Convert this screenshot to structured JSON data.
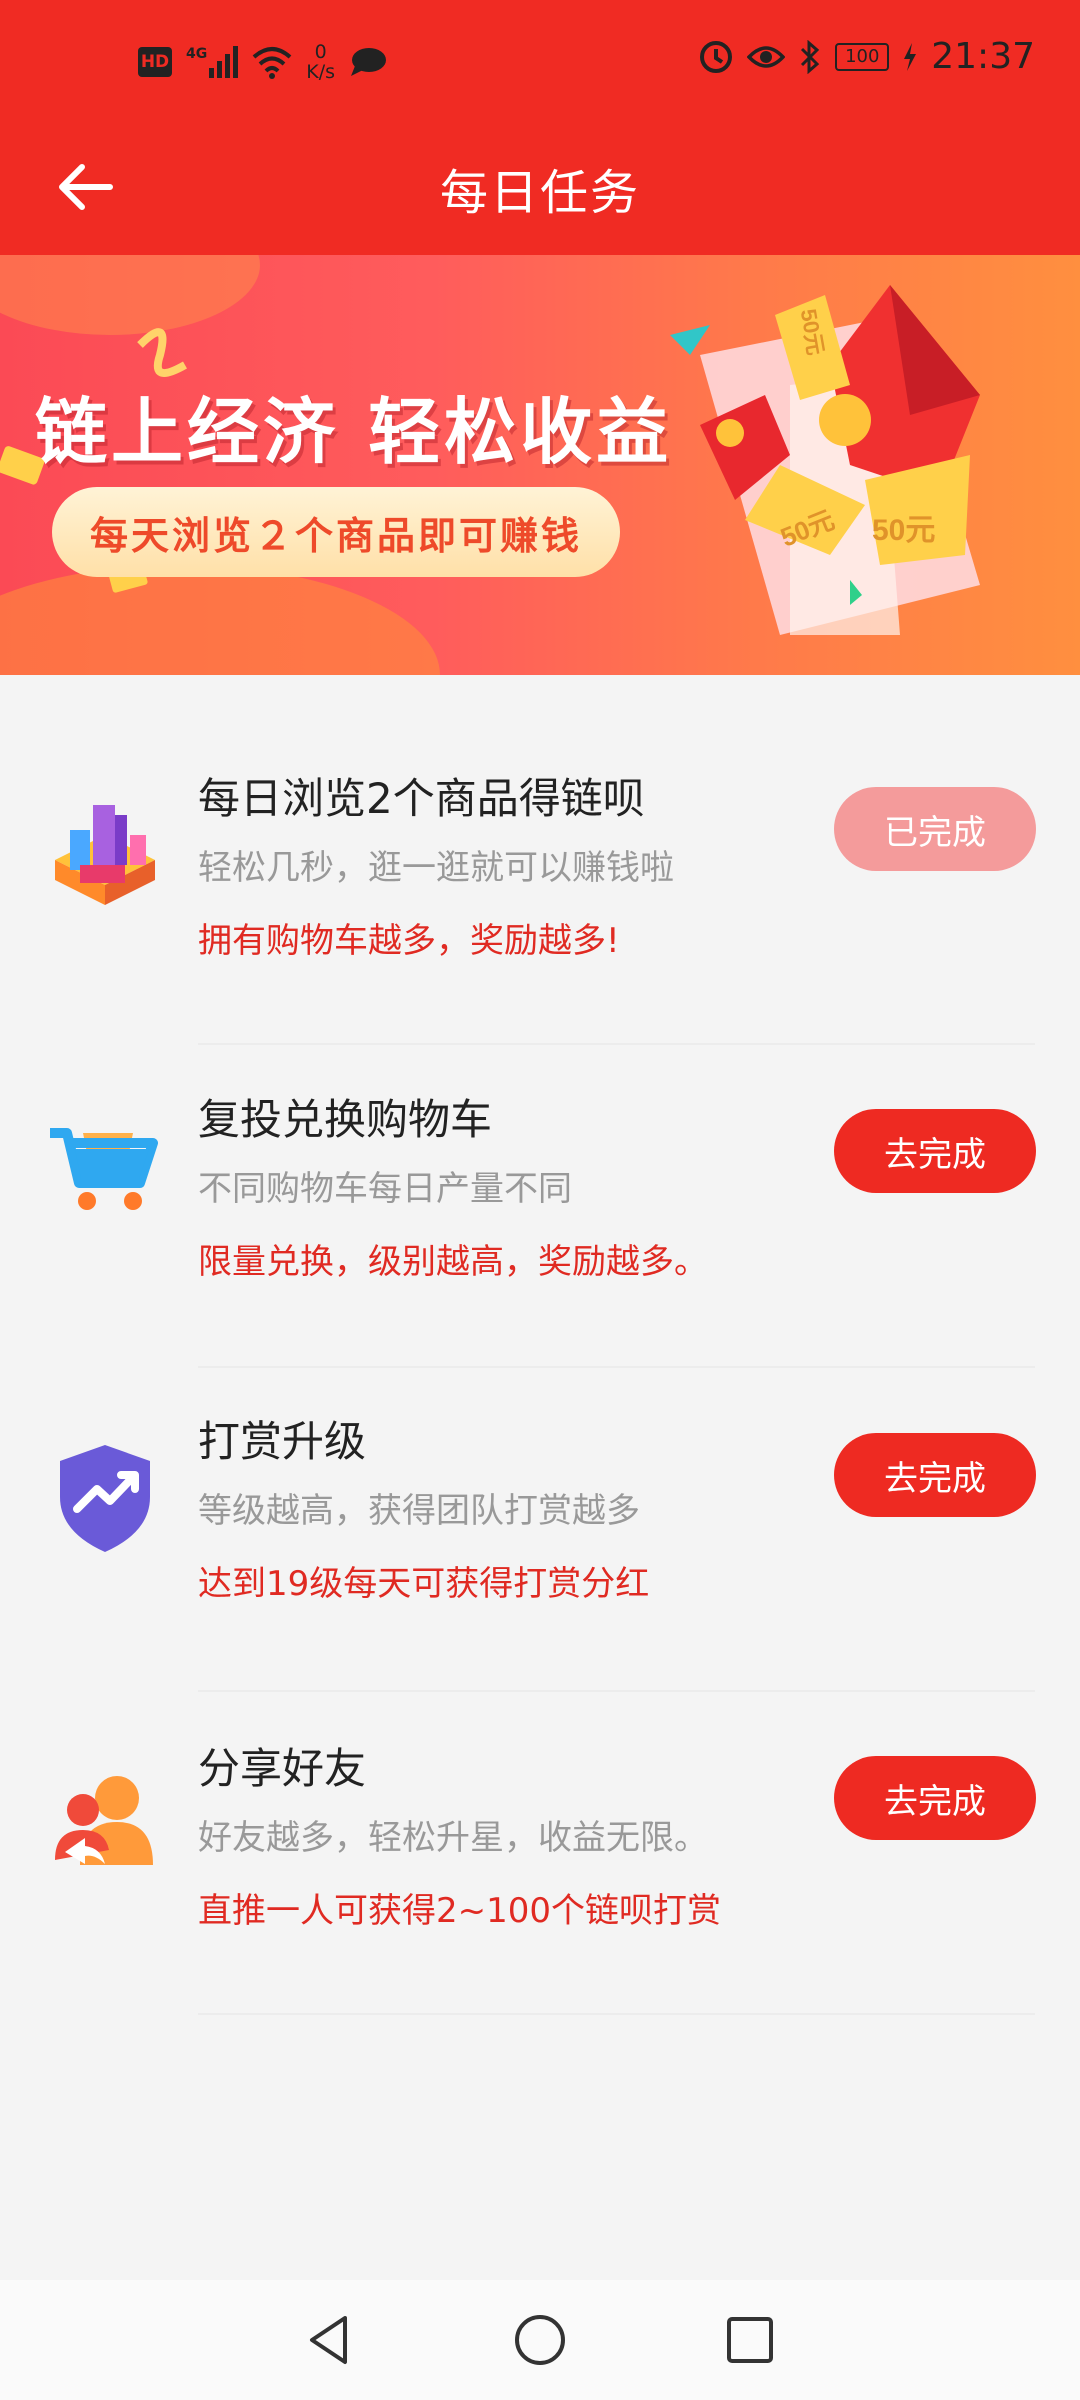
{
  "status_bar": {
    "network_badge": "HD",
    "network_type": "4G",
    "speed_value": "0",
    "speed_unit": "K/s",
    "battery": "100",
    "time": "21:37"
  },
  "header": {
    "title": "每日任务"
  },
  "banner": {
    "headline": "链上经济 轻松收益",
    "subline": "每天浏览２个商品即可赚钱",
    "coupon_1": "50元",
    "coupon_2": "50元",
    "coupon_3": "50元"
  },
  "tasks": [
    {
      "icon": "city-buildings-icon",
      "title": "每日浏览2个商品得链呗",
      "desc": "轻松几秒，逛一逛就可以赚钱啦",
      "note": "拥有购物车越多，奖励越多!",
      "button": "已完成",
      "done": true
    },
    {
      "icon": "shopping-cart-icon",
      "title": "复投兑换购物车",
      "desc": "不同购物车每日产量不同",
      "note": "限量兑换，级别越高，奖励越多。",
      "button": "去完成",
      "done": false
    },
    {
      "icon": "shield-trend-icon",
      "title": "打赏升级",
      "desc": "等级越高，获得团队打赏越多",
      "note": "达到19级每天可获得打赏分红",
      "button": "去完成",
      "done": false
    },
    {
      "icon": "share-friends-icon",
      "title": "分享好友",
      "desc": "好友越多，轻松升星，收益无限。",
      "note": "直推一人可获得2~100个链呗打赏",
      "button": "去完成",
      "done": false
    }
  ],
  "colors": {
    "brand_red": "#f02b23",
    "button_red": "#ee2a22",
    "button_done": "#f49b9b",
    "note_red": "#e02a22"
  }
}
